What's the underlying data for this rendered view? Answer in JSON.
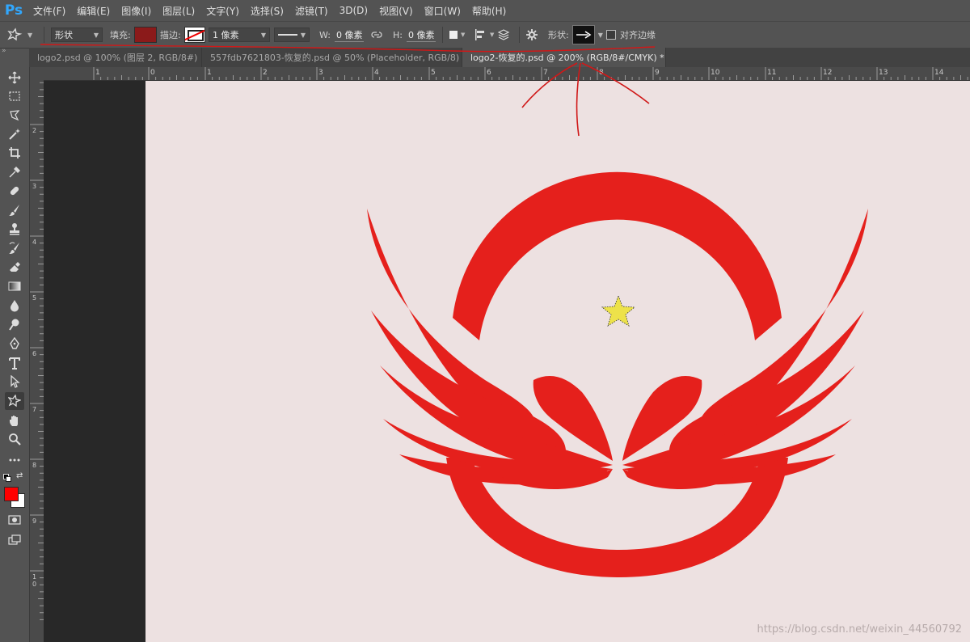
{
  "app": {
    "logo": "Ps"
  },
  "menu": [
    "文件(F)",
    "编辑(E)",
    "图像(I)",
    "图层(L)",
    "文字(Y)",
    "选择(S)",
    "滤镜(T)",
    "3D(D)",
    "视图(V)",
    "窗口(W)",
    "帮助(H)"
  ],
  "options": {
    "tool_icon": "custom-shape-tool-icon",
    "mode": "形状",
    "fill_label": "填充:",
    "fill_color": "#8b1a1a",
    "stroke_label": "描边:",
    "stroke_width": "1 像素",
    "w_label": "W:",
    "w_value": "0 像素",
    "h_label": "H:",
    "h_value": "0 像素",
    "shape_label": "形状:",
    "align_edges_label": "对齐边缘"
  },
  "tabs": [
    {
      "title": "logo2.psd @ 100% (图层 2, RGB/8#)",
      "active": false
    },
    {
      "title": "557fdb7621803-恢复的.psd @ 50% (Placeholder, RGB/8) *",
      "active": false
    },
    {
      "title": "logo2-恢复的.psd @ 200% (RGB/8#/CMYK) *",
      "active": true
    }
  ],
  "ruler_top": [
    "1",
    "0",
    "1",
    "2",
    "3",
    "4",
    "5",
    "6",
    "7",
    "8",
    "9",
    "10",
    "11",
    "12",
    "13",
    "14"
  ],
  "ruler_left": [
    "1",
    "2",
    "3",
    "4",
    "5",
    "6",
    "7",
    "8",
    "9",
    "1\n0"
  ],
  "colors": {
    "foreground": "#ff0000",
    "background": "#ffffff",
    "logo_red": "#e5201c",
    "star_yellow": "#ede24a",
    "canvas": "#ede1e1"
  },
  "watermark": "https://blog.csdn.net/weixin_44560792"
}
